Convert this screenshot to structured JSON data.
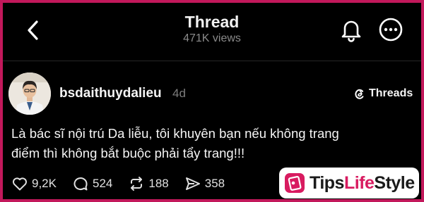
{
  "header": {
    "title": "Thread",
    "views": "471K views",
    "back_icon": "chevron-left-icon",
    "bell_icon": "bell-icon",
    "more_icon": "more-horizontal-circle-icon"
  },
  "post": {
    "username": "bsdaithuydalieu",
    "time": "4d",
    "badge": "Threads",
    "text_line1": "Là bác sĩ nội trú Da liễu, tôi khuyên bạn nếu không trang",
    "text_line2": "điểm thì không bắt buộc phải tẩy trang!!!",
    "likes": "9,2K",
    "comments": "524",
    "reposts": "188",
    "shares": "358"
  },
  "watermark": {
    "part1": "Tips",
    "part2": "Life",
    "part3": "Style",
    "accent": "#d81b60"
  },
  "colors": {
    "frame": "#c2185b",
    "background": "#000000",
    "text": "#f5f5f5",
    "muted": "#8a8a8a"
  }
}
